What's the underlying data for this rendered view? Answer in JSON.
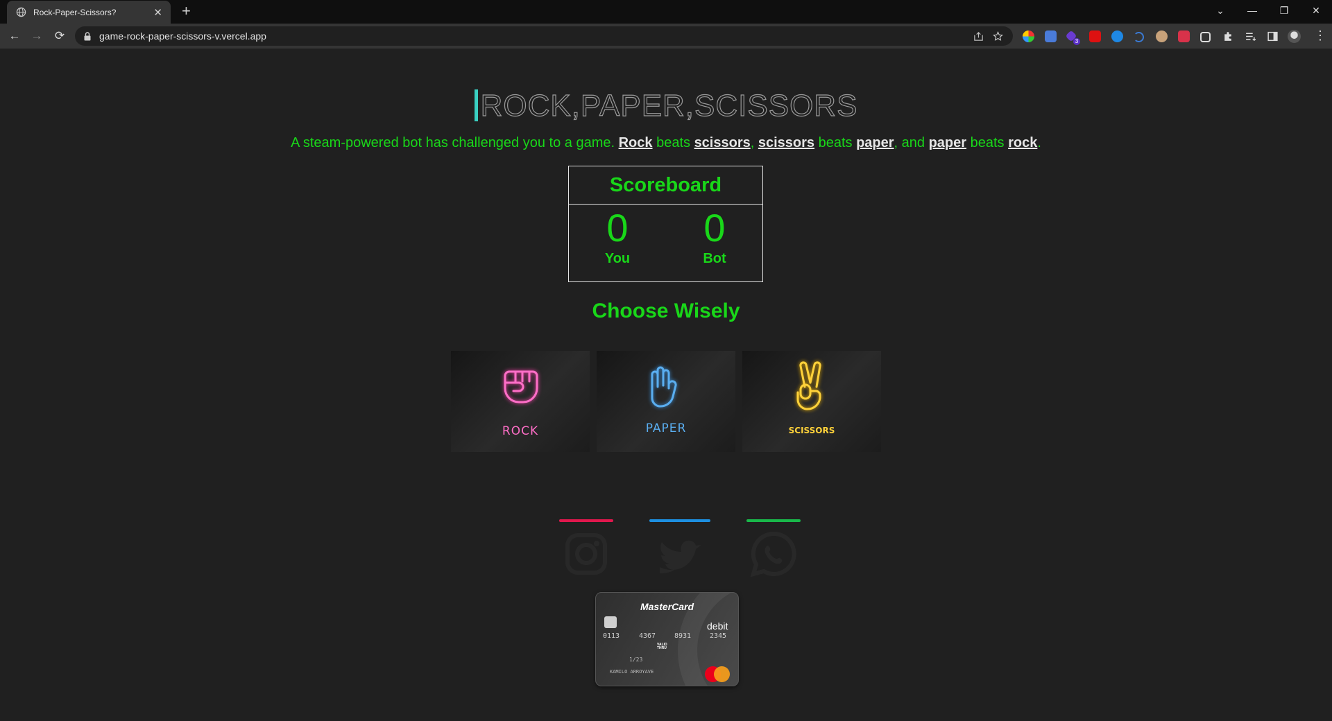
{
  "browser": {
    "tab_title": "Rock-Paper-Scissors?",
    "tab_close": "✕",
    "new_tab": "+",
    "url": "game-rock-paper-scissors-v.vercel.app",
    "window_controls": {
      "tab_search": "⌄",
      "minimize": "—",
      "restore": "❐",
      "close": "✕"
    },
    "nav": {
      "back": "←",
      "forward": "→",
      "reload": "⟳"
    },
    "extension_badge": "3"
  },
  "page": {
    "title": "ROCK,PAPER,SCISSORS",
    "intro": {
      "t1": "A steam-powered bot has challenged you to a game. ",
      "w1": "Rock",
      "t2": " beats ",
      "w2": "scissors",
      "t3": ", ",
      "w3": "scissors",
      "t4": " beats ",
      "w4": "paper",
      "t5": ", and ",
      "w5": "paper",
      "t6": " beats ",
      "w6": "rock",
      "t7": "."
    },
    "scoreboard": {
      "title": "Scoreboard",
      "you_score": "0",
      "you_label": "You",
      "bot_score": "0",
      "bot_label": "Bot"
    },
    "choose_heading": "Choose Wisely",
    "choices": [
      {
        "label": "ROCK",
        "color": "#ff6ec7"
      },
      {
        "label": "PAPER",
        "color": "#5aaef0"
      },
      {
        "label": "SCISSORS",
        "color": "#ffd23a"
      }
    ],
    "social_colors": [
      "#e0184d",
      "#1d8fe0",
      "#19b84a"
    ],
    "social_icons": [
      "instagram-icon",
      "twitter-icon",
      "whatsapp-icon"
    ],
    "card": {
      "brand": "MasterCard",
      "type": "debit",
      "digits": [
        "0113",
        "4367",
        "8931",
        "2345"
      ],
      "valid_thru": "VALID THRU",
      "expiry": "1/23",
      "holder": "KAMILO ARROYAVE"
    }
  }
}
